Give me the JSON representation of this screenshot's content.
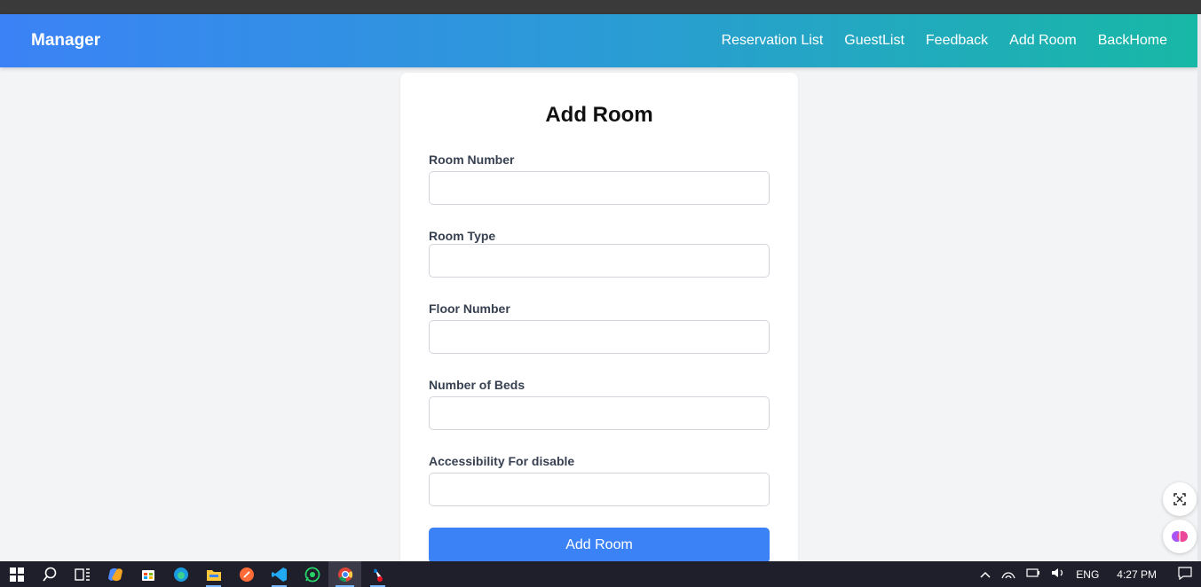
{
  "navbar": {
    "brand": "Manager",
    "links": [
      "Reservation List",
      "GuestList",
      "Feedback",
      "Add Room",
      "BackHome"
    ]
  },
  "form": {
    "title": "Add Room",
    "fields": [
      {
        "label": "Room Number",
        "value": ""
      },
      {
        "label": "Room Type",
        "value": ""
      },
      {
        "label": "Floor Number",
        "value": ""
      },
      {
        "label": "Number of Beds",
        "value": ""
      },
      {
        "label": "Accessibility For disable",
        "value": ""
      }
    ],
    "submit_label": "Add Room"
  },
  "colors": {
    "gradient_start": "#3b82f6",
    "gradient_end": "#18b8a6",
    "button": "#3b82f6"
  },
  "taskbar": {
    "apps": [
      "windows-start-icon",
      "search-icon",
      "task-view-icon",
      "copilot-icon",
      "store-icon",
      "edge-icon",
      "file-explorer-icon",
      "postman-icon",
      "vscode-icon",
      "whatsapp-icon",
      "chrome-icon",
      "paint-icon"
    ],
    "tray": {
      "language": "ENG",
      "time": "4:27 PM"
    }
  }
}
